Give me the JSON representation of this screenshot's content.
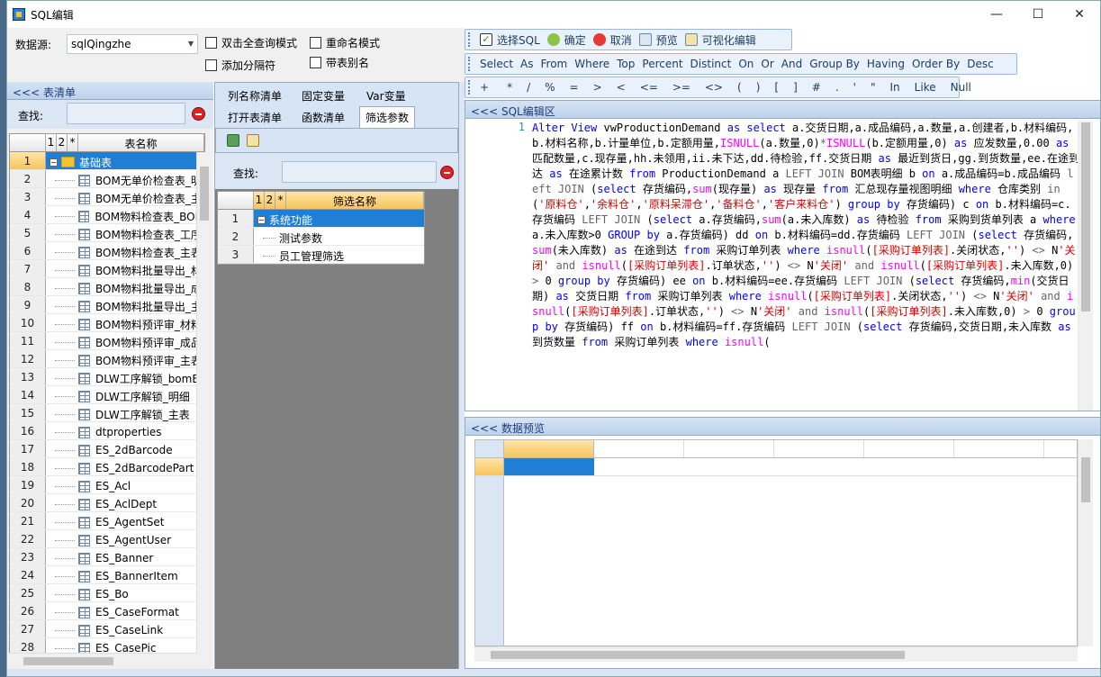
{
  "window": {
    "title": "SQL编辑",
    "minimize": "—",
    "maximize": "☐",
    "close": "✕"
  },
  "top": {
    "datasource_label": "数据源:",
    "datasource_value": "sqlQingzhe",
    "cb_dblclick": "双击全查询模式",
    "cb_rename": "重命名模式",
    "cb_separator": "添加分隔符",
    "cb_alias": "带表别名"
  },
  "toolbar1": [
    "选择SQL",
    "确定",
    "取消",
    "预览",
    "可视化编辑"
  ],
  "toolbar2": [
    "Select",
    "As",
    "From",
    "Where",
    "Top",
    "Percent",
    "Distinct",
    "On",
    "Or",
    "And",
    "Group By",
    "Having",
    "Order By",
    "Desc"
  ],
  "toolbar3": [
    "+",
    "*",
    "/",
    "%",
    "=",
    ">",
    "<",
    "<=",
    ">=",
    "<>",
    "(",
    ")",
    "[",
    "]",
    "#",
    ".",
    "'",
    "\"",
    "In",
    "Like",
    "Null"
  ],
  "left": {
    "header": "<<< 表清单",
    "find_label": "查找:",
    "col_1": "1",
    "col_2": "2",
    "col_star": "*",
    "col_name": "表名称",
    "rows": [
      {
        "n": "1",
        "t": "基础表"
      },
      {
        "n": "2",
        "t": "BOM无单价检查表_明"
      },
      {
        "n": "3",
        "t": "BOM无单价检查表_主"
      },
      {
        "n": "4",
        "t": "BOM物料检查表_BOM"
      },
      {
        "n": "5",
        "t": "BOM物料检查表_工序"
      },
      {
        "n": "6",
        "t": "BOM物料检查表_主表"
      },
      {
        "n": "7",
        "t": "BOM物料批量导出_材"
      },
      {
        "n": "8",
        "t": "BOM物料批量导出_成"
      },
      {
        "n": "9",
        "t": "BOM物料批量导出_主"
      },
      {
        "n": "10",
        "t": "BOM物料预评审_材料"
      },
      {
        "n": "11",
        "t": "BOM物料预评审_成品"
      },
      {
        "n": "12",
        "t": "BOM物料预评审_主表"
      },
      {
        "n": "13",
        "t": "DLW工序解锁_bomB"
      },
      {
        "n": "14",
        "t": "DLW工序解锁_明细"
      },
      {
        "n": "15",
        "t": "DLW工序解锁_主表"
      },
      {
        "n": "16",
        "t": "dtproperties"
      },
      {
        "n": "17",
        "t": "ES_2dBarcode"
      },
      {
        "n": "18",
        "t": "ES_2dBarcodePart"
      },
      {
        "n": "19",
        "t": "ES_Acl"
      },
      {
        "n": "20",
        "t": "ES_AclDept"
      },
      {
        "n": "21",
        "t": "ES_AgentSet"
      },
      {
        "n": "22",
        "t": "ES_AgentUser"
      },
      {
        "n": "23",
        "t": "ES_Banner"
      },
      {
        "n": "24",
        "t": "ES_BannerItem"
      },
      {
        "n": "25",
        "t": "ES_Bo"
      },
      {
        "n": "26",
        "t": "ES_CaseFormat"
      },
      {
        "n": "27",
        "t": "ES_CaseLink"
      },
      {
        "n": "28",
        "t": "ES_CasePic"
      }
    ]
  },
  "mid": {
    "tabs": [
      "列名称清单",
      "固定变量",
      "Var变量",
      "打开表清单",
      "函数清单",
      "筛选参数"
    ],
    "find_label": "查找:",
    "col_1": "1",
    "col_2": "2",
    "col_star": "*",
    "col_name": "筛选名称",
    "rows": [
      {
        "n": "1",
        "t": "系统功能"
      },
      {
        "n": "2",
        "t": "测试参数"
      },
      {
        "n": "3",
        "t": "员工管理筛选"
      }
    ]
  },
  "editor": {
    "header": "<<< SQL编辑区",
    "line": "1"
  },
  "preview": {
    "header": "<<< 数据预览"
  }
}
